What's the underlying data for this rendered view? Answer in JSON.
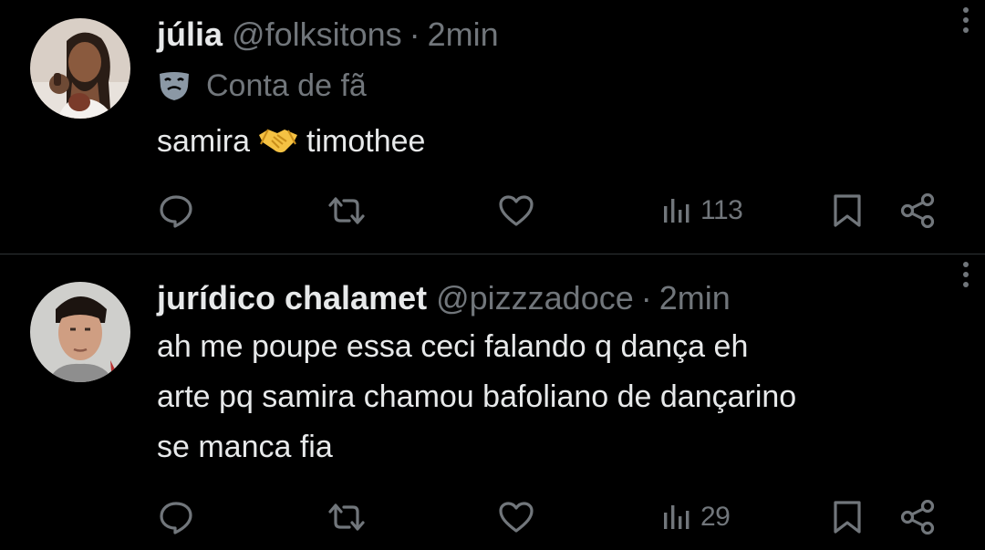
{
  "colors": {
    "background": "#000000",
    "text_primary": "#e7e9ea",
    "text_secondary": "#71767b",
    "divider": "#2f3336",
    "handshake_emoji": "#f5c243"
  },
  "tweets": [
    {
      "name": "júlia",
      "handle": "@folksitons",
      "separator": "·",
      "time": "2min",
      "badge_icon": "theater-mask-icon",
      "badge_label": "Conta de fã",
      "text_before_emoji": "samira",
      "emoji": "handshake-emoji",
      "text_after_emoji": "timothee",
      "views": "113",
      "icons": [
        "reply-icon",
        "retweet-icon",
        "heart-icon",
        "views-icon",
        "bookmark-icon",
        "share-icon",
        "more-icon"
      ]
    },
    {
      "name": "jurídico chalamet",
      "handle": "@pizzzadoce",
      "separator": "·",
      "time": "2min",
      "text": "ah me poupe essa ceci falando q dança eh\narte pq samira chamou bafoliano de dançarino\nse manca fia",
      "views": "29",
      "icons": [
        "reply-icon",
        "retweet-icon",
        "heart-icon",
        "views-icon",
        "bookmark-icon",
        "share-icon",
        "more-icon"
      ]
    }
  ]
}
